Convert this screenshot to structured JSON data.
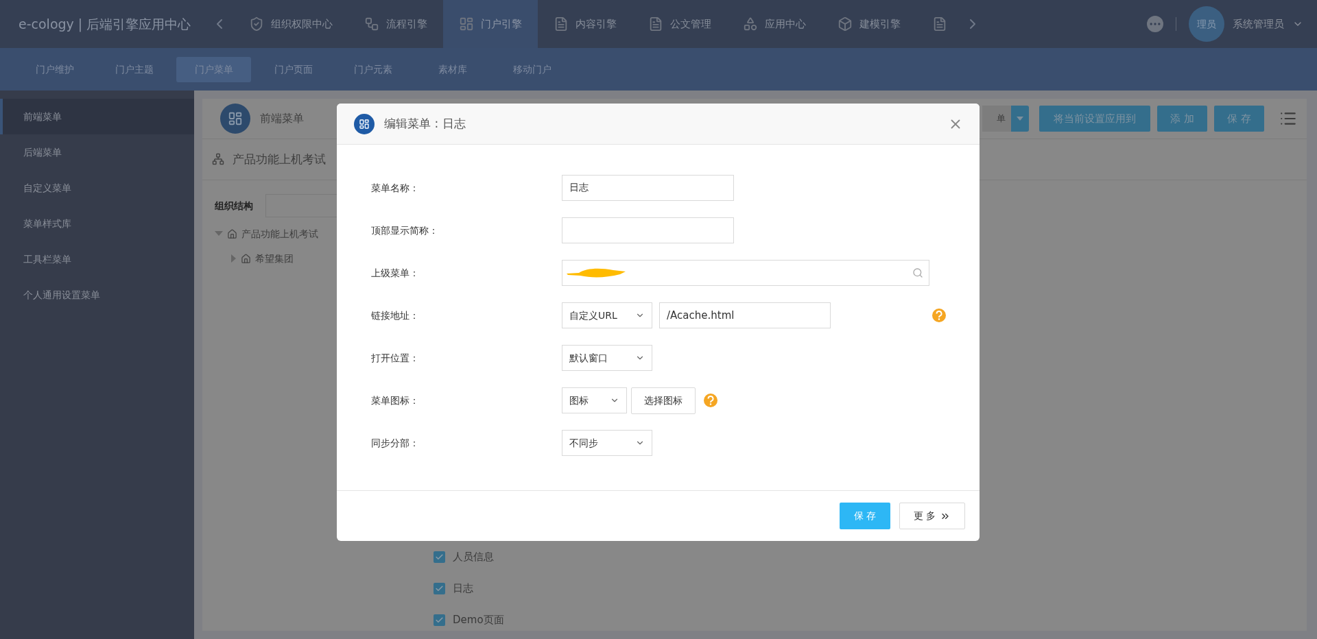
{
  "app_title": "e-cology | 后端引擎应用中心",
  "top_tabs": [
    {
      "label": "组织权限中心",
      "selected": false
    },
    {
      "label": "流程引擎",
      "selected": false
    },
    {
      "label": "门户引擎",
      "selected": true
    },
    {
      "label": "内容引擎",
      "selected": false
    },
    {
      "label": "公文管理",
      "selected": false
    },
    {
      "label": "应用中心",
      "selected": false
    },
    {
      "label": "建模引擎",
      "selected": false
    },
    {
      "selected": false
    }
  ],
  "user": {
    "avatar_text": "理员",
    "name": "系统管理员"
  },
  "sub_nav": [
    {
      "label": "门户维护",
      "selected": false
    },
    {
      "label": "门户主题",
      "selected": false
    },
    {
      "label": "门户菜单",
      "selected": true
    },
    {
      "label": "门户页面",
      "selected": false
    },
    {
      "label": "门户元素",
      "selected": false
    },
    {
      "label": "素材库",
      "selected": false
    },
    {
      "label": "移动门户",
      "selected": false
    }
  ],
  "sidebar": [
    {
      "label": "前端菜单",
      "selected": true
    },
    {
      "label": "后端菜单",
      "selected": false
    },
    {
      "label": "自定义菜单",
      "selected": false
    },
    {
      "label": "菜单样式库",
      "selected": false
    },
    {
      "label": "工具栏菜单",
      "selected": false
    },
    {
      "label": "个人通用设置菜单",
      "selected": false
    }
  ],
  "panel": {
    "title": "前端菜单",
    "dropdown_text": "单",
    "buttons": [
      "将当前设置应用到",
      "添 加",
      "保 存"
    ],
    "tree_title": "产品功能上机考试",
    "org_label": "组织结构",
    "tree": [
      {
        "label": "产品功能上机考试",
        "expanded": true,
        "children": [
          {
            "label": "希望集团",
            "expanded": false
          }
        ]
      }
    ],
    "menu_items": [
      {
        "label": "人员信息",
        "checked": true
      },
      {
        "label": "日志",
        "checked": true
      },
      {
        "label": "Demo页面",
        "checked": true
      }
    ]
  },
  "dialog": {
    "title": "编辑菜单 : 日志",
    "fields": [
      {
        "kind": "text",
        "label": "菜单名称：",
        "value": "日志"
      },
      {
        "kind": "text",
        "label": "顶部显示简称："
      },
      {
        "kind": "search",
        "label": "上级菜单："
      },
      {
        "kind": "select_text",
        "label": "链接地址：",
        "select": "自定义URL",
        "value": "/Acache.html",
        "help": true
      },
      {
        "kind": "select",
        "label": "打开位置：",
        "select": "默认窗口"
      },
      {
        "kind": "select_button",
        "label": "菜单图标：",
        "select": "图标",
        "button": "选择图标",
        "help": true
      },
      {
        "kind": "select",
        "label": "同步分部：",
        "select": "不同步"
      }
    ],
    "buttons": [
      {
        "kind": "primary",
        "label": "保 存"
      },
      {
        "kind": "more",
        "label": "更 多"
      }
    ]
  }
}
